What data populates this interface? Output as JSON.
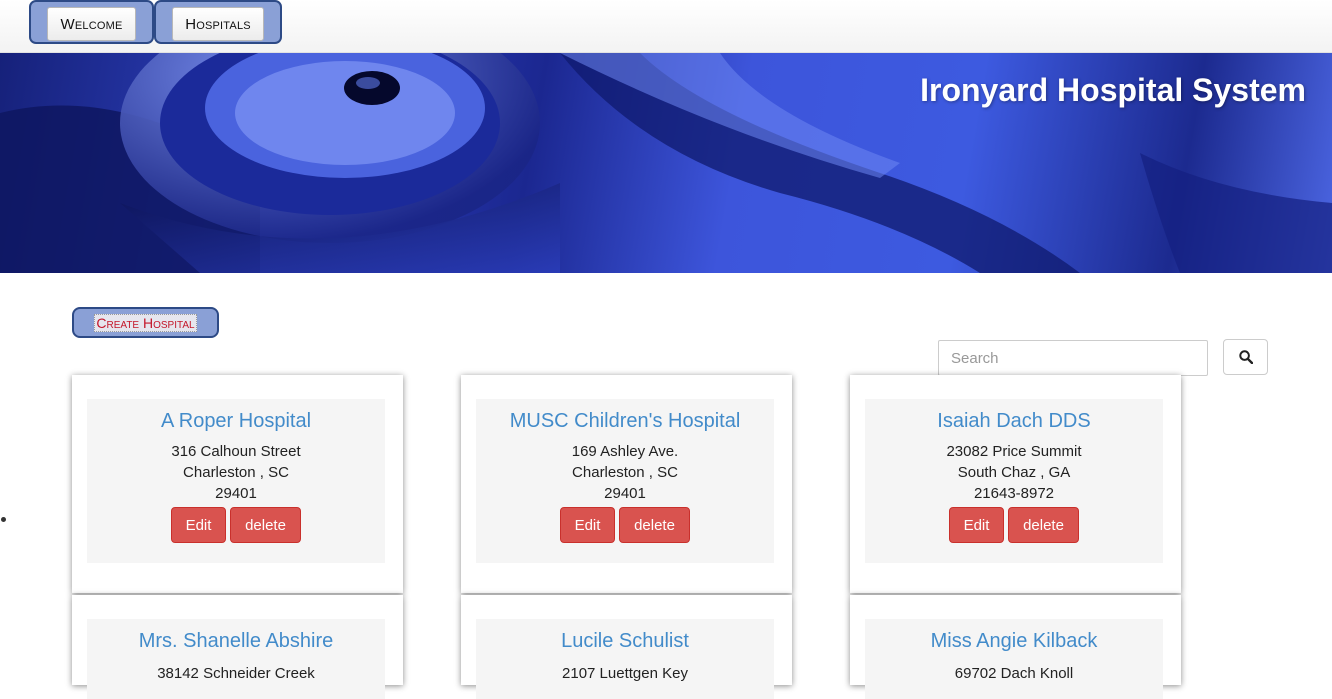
{
  "nav": {
    "tabs": [
      {
        "label": "Welcome"
      },
      {
        "label": "Hospitals"
      }
    ]
  },
  "hero": {
    "title": "Ironyard Hospital System"
  },
  "actions": {
    "create_label": "Create Hospital"
  },
  "search": {
    "placeholder": "Search",
    "icon": "search-icon"
  },
  "hospitals": [
    {
      "name": "A Roper Hospital",
      "street": "316 Calhoun Street",
      "city_state": "Charleston , SC",
      "zip": "29401",
      "edit_label": "Edit",
      "delete_label": "delete"
    },
    {
      "name": "MUSC Children's Hospital",
      "street": "169 Ashley Ave.",
      "city_state": "Charleston , SC",
      "zip": "29401",
      "edit_label": "Edit",
      "delete_label": "delete"
    },
    {
      "name": "Isaiah Dach DDS",
      "street": "23082 Price Summit",
      "city_state": "South Chaz , GA",
      "zip": "21643-8972",
      "edit_label": "Edit",
      "delete_label": "delete"
    },
    {
      "name": "Mrs. Shanelle Abshire",
      "street": "38142 Schneider Creek"
    },
    {
      "name": "Lucile Schulist",
      "street": "2107 Luettgen Key"
    },
    {
      "name": "Miss Angie Kilback",
      "street": "69702 Dach Knoll"
    }
  ],
  "colors": {
    "nav_border": "#2d4a86",
    "nav_fill": "#8aa0d6",
    "link_blue": "#428bca",
    "danger_red": "#d9534f",
    "create_text": "#c4162a"
  }
}
